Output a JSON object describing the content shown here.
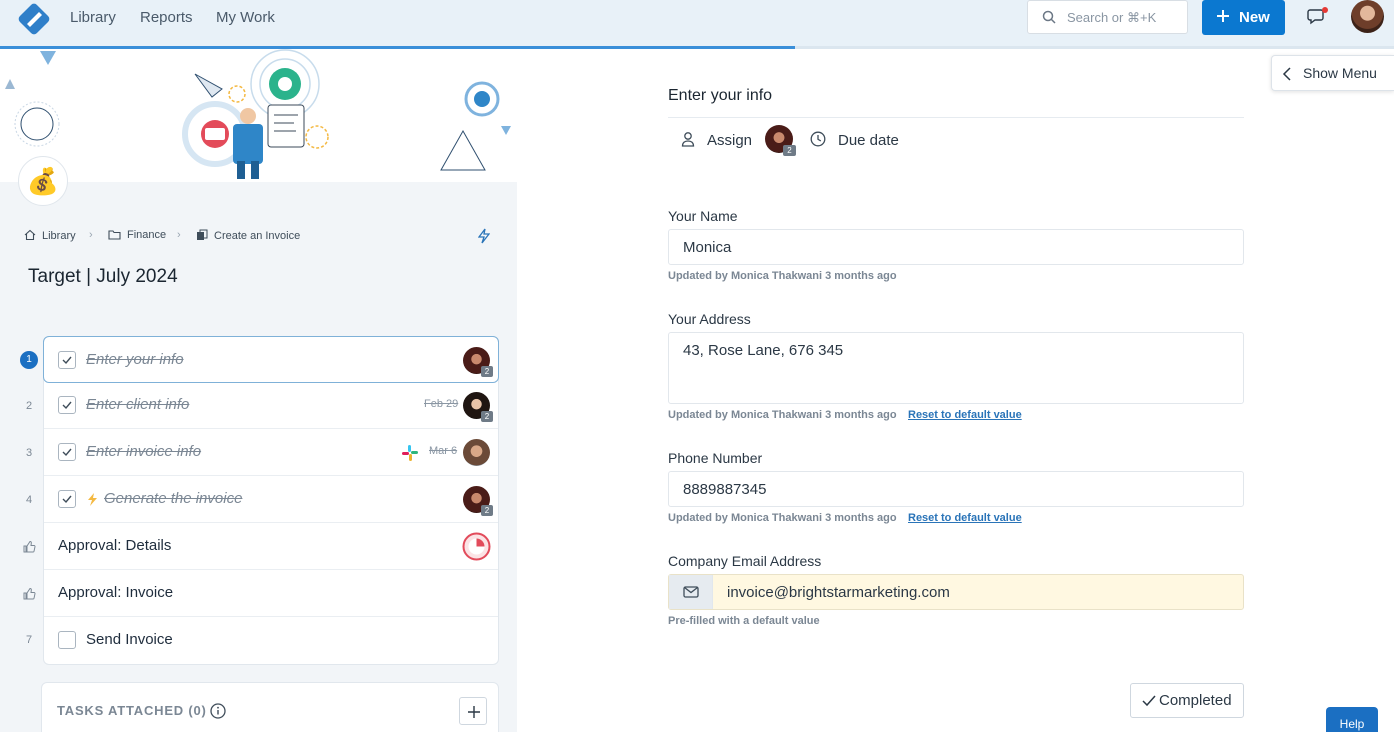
{
  "nav": {
    "links": [
      "Library",
      "Reports",
      "My Work"
    ],
    "search_placeholder": "Search or ⌘+K",
    "new_label": "New",
    "progress": 0.57
  },
  "left": {
    "breadcrumb": [
      "Library",
      "Finance",
      "Create an Invoice"
    ],
    "title": "Target | July 2024",
    "steps": [
      {
        "num": "1",
        "label": "Enter your info",
        "done": true,
        "due": "",
        "badge": "2"
      },
      {
        "num": "2",
        "label": "Enter client info",
        "done": true,
        "due": "Feb 29",
        "badge": "2"
      },
      {
        "num": "3",
        "label": "Enter invoice info",
        "done": true,
        "due": "Mar 6",
        "badge": ""
      },
      {
        "num": "4",
        "label": "Generate the invoice",
        "done": true,
        "due": "",
        "badge": "2"
      },
      {
        "num": "",
        "label": "Approval: Details",
        "done": false,
        "due": "",
        "badge": ""
      },
      {
        "num": "",
        "label": "Approval: Invoice",
        "done": false,
        "due": "",
        "badge": ""
      },
      {
        "num": "7",
        "label": "Send Invoice",
        "done": false,
        "due": "",
        "badge": ""
      }
    ],
    "tasks_label": "TASKS ATTACHED (0)"
  },
  "form": {
    "title": "Enter your info",
    "assign_label": "Assign",
    "assign_badge": "2",
    "due_label": "Due date",
    "name_label": "Your Name",
    "name_value": "Monica",
    "name_meta": "Updated by Monica Thakwani 3 months ago",
    "address_label": "Your Address",
    "address_value": "43, Rose Lane, 676 345",
    "address_meta": "Updated by Monica Thakwani 3 months ago",
    "phone_label": "Phone Number",
    "phone_value": "8889887345",
    "phone_meta": "Updated by Monica Thakwani 3 months ago",
    "reset_label": "Reset to default value",
    "email_label": "Company Email Address",
    "email_value": "invoice@brightstarmarketing.com",
    "email_meta": "Pre-filled with a default value",
    "completed_label": "Completed"
  },
  "show_menu_label": "Show Menu",
  "help_label": "Help",
  "colors": {
    "primary": "#0b78d0",
    "accent_bg": "#e8f1f8",
    "prefill": "#fff8e1"
  }
}
